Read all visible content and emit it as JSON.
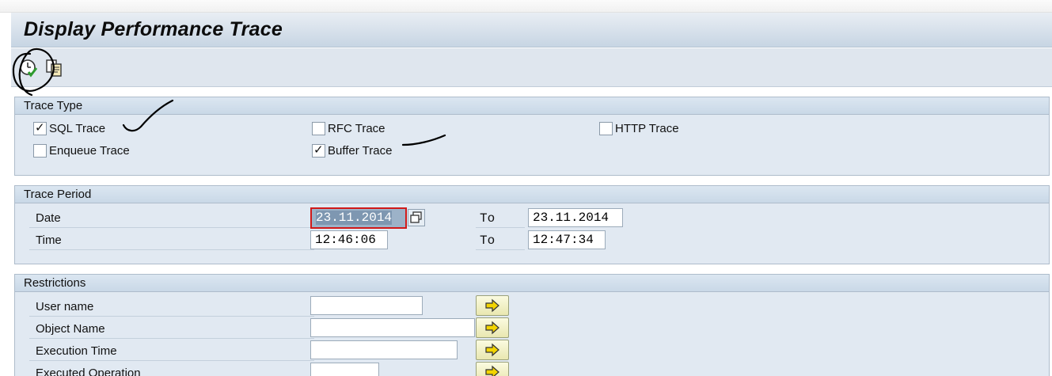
{
  "title": "Display Performance Trace",
  "toolbar": {
    "icons": [
      "execute-clock-icon",
      "copy-variant-icon"
    ]
  },
  "trace_type": {
    "heading": "Trace Type",
    "options": [
      {
        "label": "SQL Trace",
        "checked": true
      },
      {
        "label": "RFC Trace",
        "checked": false
      },
      {
        "label": "HTTP Trace",
        "checked": false
      },
      {
        "label": "Enqueue Trace",
        "checked": false
      },
      {
        "label": "Buffer Trace",
        "checked": true
      }
    ],
    "check_glyph": "✓"
  },
  "trace_period": {
    "heading": "Trace Period",
    "date_label": "Date",
    "time_label": "Time",
    "to_label": "To",
    "date_from": "23.11.2014",
    "date_to": "23.11.2014",
    "time_from": "12:46:06",
    "time_to": "12:47:34"
  },
  "restrictions": {
    "heading": "Restrictions",
    "rows": [
      {
        "label": "User name",
        "value": ""
      },
      {
        "label": "Object Name",
        "value": ""
      },
      {
        "label": "Execution Time",
        "value": ""
      },
      {
        "label": "Executed Operation",
        "value": ""
      }
    ]
  },
  "colors": {
    "accent_arrow": "#f2d400",
    "selection_border": "#d01919"
  }
}
